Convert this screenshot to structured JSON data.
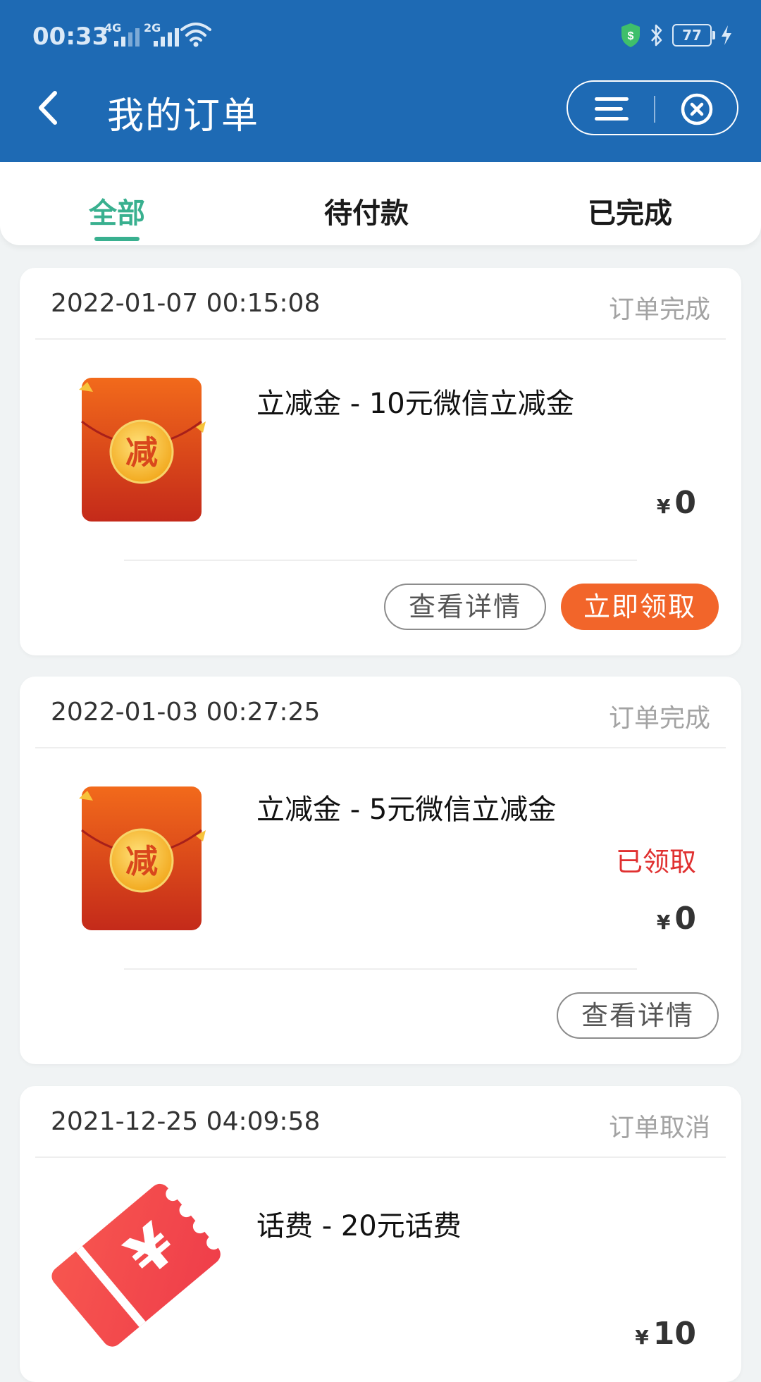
{
  "status_bar": {
    "time": "00:33",
    "network1": "4G",
    "network2": "2G",
    "battery": "77"
  },
  "header": {
    "title": "我的订单"
  },
  "tabs": [
    {
      "label": "全部",
      "active": true
    },
    {
      "label": "待付款",
      "active": false
    },
    {
      "label": "已完成",
      "active": false
    }
  ],
  "orders": [
    {
      "date": "2022-01-07 00:15:08",
      "status": "订单完成",
      "product": "立减金 - 10元微信立减金",
      "image_icon": "red-envelope-icon",
      "currency": "¥",
      "price": "0",
      "detail_button": "查看详情",
      "claim_button": "立即领取"
    },
    {
      "date": "2022-01-03 00:27:25",
      "status": "订单完成",
      "product": "立减金 - 5元微信立减金",
      "image_icon": "red-envelope-icon",
      "claimed_label": "已领取",
      "currency": "¥",
      "price": "0",
      "detail_button": "查看详情"
    },
    {
      "date": "2021-12-25 04:09:58",
      "status": "订单取消",
      "product": "话费 - 20元话费",
      "image_icon": "phone-bill-ticket-icon",
      "currency": "¥",
      "price": "10"
    }
  ],
  "colors": {
    "header_bg": "#1e6ab4",
    "tab_active": "#39b08f",
    "primary_button": "#f2652a",
    "claimed_text": "#e03030"
  }
}
